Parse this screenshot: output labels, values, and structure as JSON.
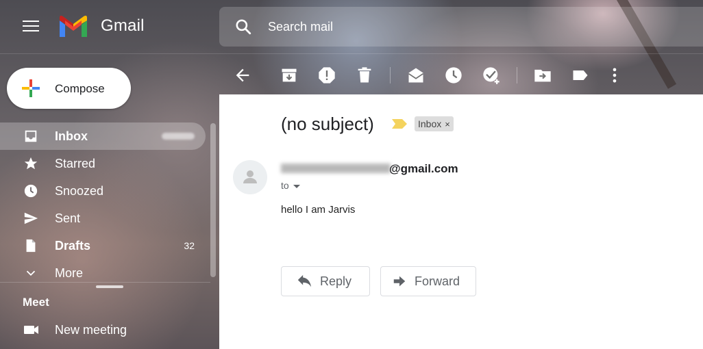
{
  "header": {
    "brand": "Gmail",
    "search_placeholder": "Search mail"
  },
  "compose": {
    "label": "Compose"
  },
  "nav": {
    "items": [
      {
        "label": "Inbox",
        "count": "",
        "icon": "inbox-icon"
      },
      {
        "label": "Starred",
        "count": "",
        "icon": "star-icon"
      },
      {
        "label": "Snoozed",
        "count": "",
        "icon": "clock-icon"
      },
      {
        "label": "Sent",
        "count": "",
        "icon": "send-icon"
      },
      {
        "label": "Drafts",
        "count": "32",
        "icon": "draft-icon"
      },
      {
        "label": "More",
        "count": "",
        "icon": "chevron-down-icon"
      }
    ]
  },
  "meet": {
    "title": "Meet",
    "new_meeting": "New meeting"
  },
  "toolbar": {
    "icons": [
      "back-arrow-icon",
      "archive-icon",
      "report-spam-icon",
      "delete-icon",
      "mark-unread-icon",
      "snooze-icon",
      "add-to-tasks-icon",
      "move-to-icon",
      "label-icon",
      "more-vert-icon"
    ]
  },
  "message": {
    "subject": "(no subject)",
    "label": "Inbox",
    "label_remove": "×",
    "sender_domain": "@gmail.com",
    "to": "to",
    "body": "hello I am Jarvis"
  },
  "actions": {
    "reply": "Reply",
    "forward": "Forward"
  },
  "colors": {
    "panel_bg": "#ffffff",
    "importance_marker": "#f4d35e",
    "label_chip": "#dddddd"
  }
}
